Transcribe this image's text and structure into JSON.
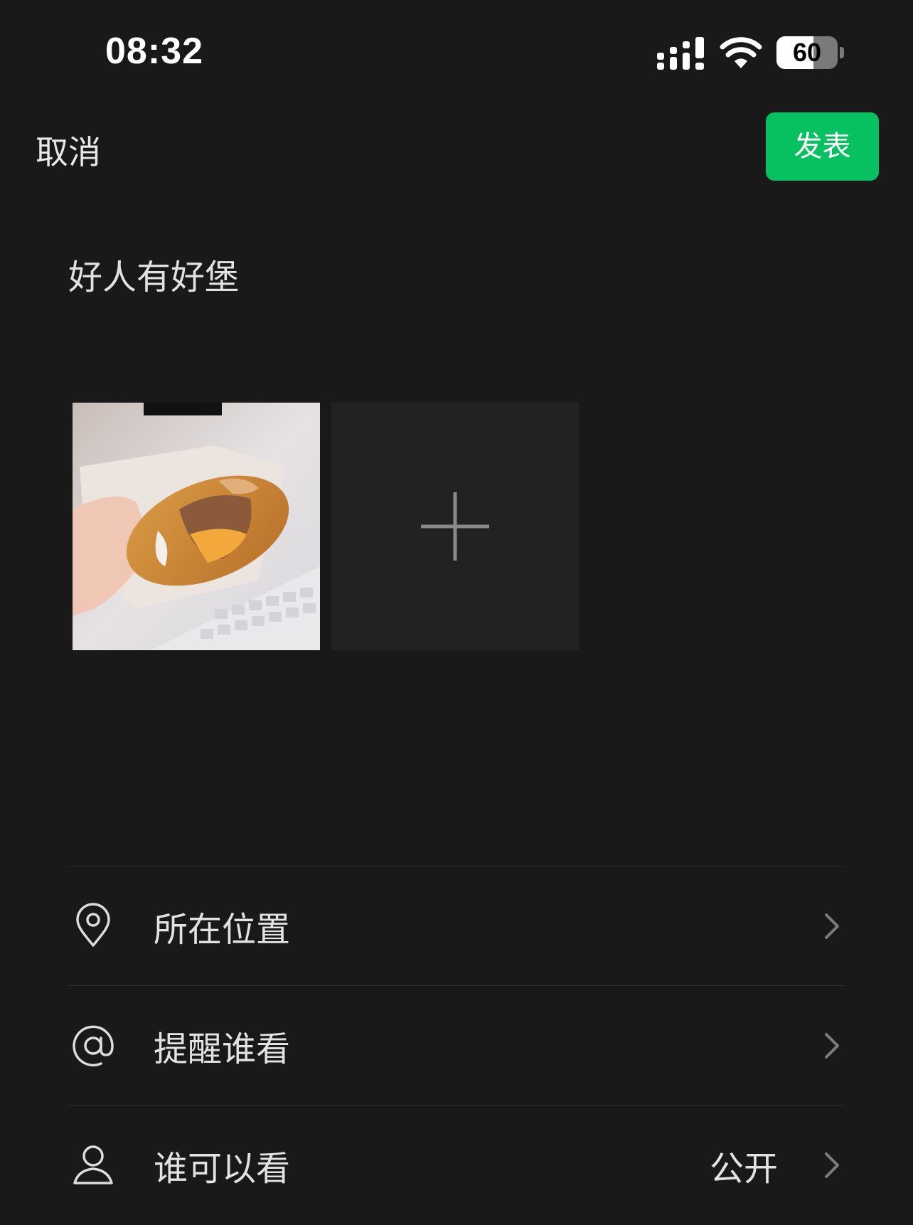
{
  "status_bar": {
    "time": "08:32",
    "battery_level": "60",
    "battery_fraction": 0.6,
    "icons": [
      "signal-icon",
      "wifi-icon",
      "battery-icon"
    ]
  },
  "header": {
    "cancel_label": "取消",
    "publish_label": "发表",
    "accent_color": "#07c160"
  },
  "post": {
    "text": "好人有好堡",
    "images": [
      {
        "description_icon": "burger-photo"
      }
    ],
    "add_icon": "plus-icon"
  },
  "options": [
    {
      "icon": "location-pin-icon",
      "label": "所在位置",
      "value": ""
    },
    {
      "icon": "at-sign-icon",
      "label": "提醒谁看",
      "value": ""
    },
    {
      "icon": "person-icon",
      "label": "谁可以看",
      "value": "公开"
    }
  ]
}
